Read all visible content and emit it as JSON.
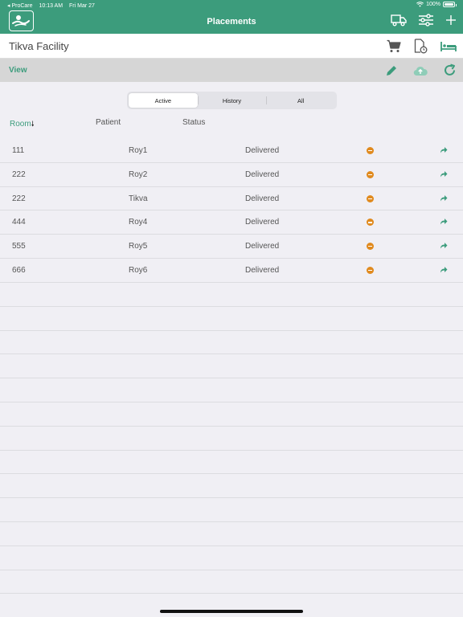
{
  "status_bar": {
    "back_app": "◂ ProCare",
    "time": "10:13 AM",
    "date": "Fri Mar 27",
    "battery": "100%"
  },
  "nav": {
    "title": "Placements",
    "icons": [
      "logo-icon",
      "truck-icon",
      "sliders-icon",
      "plus-icon"
    ]
  },
  "facility": {
    "name": "Tikva Facility",
    "icons": [
      "cart-icon",
      "document-clock-icon",
      "bed-icon"
    ]
  },
  "view_bar": {
    "label": "View",
    "icons": [
      "pencil-icon",
      "cloud-upload-icon",
      "refresh-icon"
    ]
  },
  "tabs": [
    {
      "label": "Active",
      "selected": true
    },
    {
      "label": "History",
      "selected": false
    },
    {
      "label": "All",
      "selected": false
    }
  ],
  "columns": {
    "room": "Room",
    "sort_indicator": "🠗",
    "patient": "Patient",
    "status": "Status"
  },
  "rows": [
    {
      "room": "111",
      "patient": "Roy1",
      "status": "Delivered"
    },
    {
      "room": "222",
      "patient": "Roy2",
      "status": "Delivered"
    },
    {
      "room": "222",
      "patient": "Tikva",
      "status": "Delivered"
    },
    {
      "room": "444",
      "patient": "Roy4",
      "status": "Delivered"
    },
    {
      "room": "555",
      "patient": "Roy5",
      "status": "Delivered"
    },
    {
      "room": "666",
      "patient": "Roy6",
      "status": "Delivered"
    }
  ],
  "colors": {
    "accent": "#3c9c7c",
    "remove": "#e08a1e",
    "background": "#f0eff4"
  }
}
